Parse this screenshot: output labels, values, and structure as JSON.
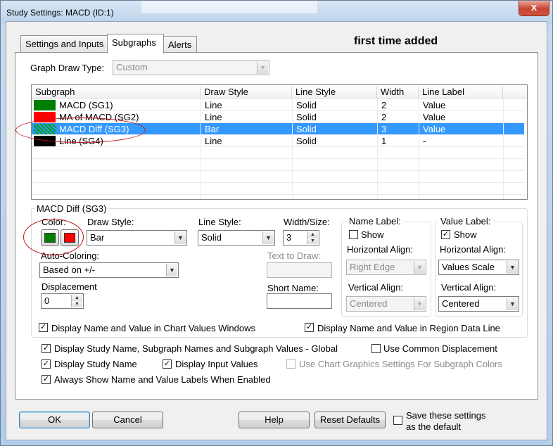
{
  "window": {
    "title": "Study Settings: MACD (ID:1)",
    "close_glyph": "x"
  },
  "tabs": [
    {
      "label": "Settings and Inputs",
      "active": false
    },
    {
      "label": "Subgraphs",
      "active": true
    },
    {
      "label": "Alerts",
      "active": false
    }
  ],
  "annotation_note": "first time added",
  "graph_draw_type": {
    "label": "Graph Draw Type:",
    "value": "Custom"
  },
  "subgraph_list": {
    "columns": [
      "Subgraph",
      "Draw Style",
      "Line Style",
      "Width",
      "Line Label"
    ],
    "rows": [
      {
        "color": "#008000",
        "name": "MACD (SG1)",
        "draw_style": "Line",
        "line_style": "Solid",
        "width": "2",
        "line_label": "Value",
        "selected": false
      },
      {
        "color": "#ff0000",
        "name": "MA of MACD (SG2)",
        "draw_style": "Line",
        "line_style": "Solid",
        "width": "2",
        "line_label": "Value",
        "selected": false
      },
      {
        "color": "#00a000",
        "name": "MACD Diff (SG3)",
        "draw_style": "Bar",
        "line_style": "Solid",
        "width": "3",
        "line_label": "Value",
        "selected": true
      },
      {
        "color": "#000000",
        "name": "Line (SG4)",
        "draw_style": "Line",
        "line_style": "Solid",
        "width": "1",
        "line_label": "-",
        "selected": false
      }
    ]
  },
  "selected_group": {
    "title": "MACD Diff (SG3)",
    "color_label": "Color:",
    "primary_color": "#008000",
    "secondary_color": "#ff0000",
    "draw_style_label": "Draw Style:",
    "draw_style_value": "Bar",
    "line_style_label": "Line Style:",
    "line_style_value": "Solid",
    "width_label": "Width/Size:",
    "width_value": "3",
    "auto_coloring_label": "Auto-Coloring:",
    "auto_coloring_value": "Based on +/-",
    "text_to_draw_label": "Text to Draw:",
    "text_to_draw_value": "",
    "displacement_label": "Displacement",
    "displacement_value": "0",
    "short_name_label": "Short Name:",
    "short_name_value": "",
    "name_label": {
      "title": "Name Label:",
      "show_label": "Show",
      "show_checked": false,
      "h_align_label": "Horizontal Align:",
      "h_align_value": "Right Edge",
      "v_align_label": "Vertical Align:",
      "v_align_value": "Centered"
    },
    "value_label": {
      "title": "Value Label:",
      "show_label": "Show",
      "show_checked": true,
      "h_align_label": "Horizontal Align:",
      "h_align_value": "Values Scale",
      "v_align_label": "Vertical Align:",
      "v_align_value": "Centered"
    },
    "display_chart_values_label": "Display Name and Value in Chart Values Windows",
    "display_chart_values_checked": true,
    "display_region_label": "Display Name and Value in Region Data Line",
    "display_region_checked": true
  },
  "global_options": {
    "display_study_global_label": "Display Study Name, Subgraph Names and Subgraph Values - Global",
    "display_study_global_checked": true,
    "use_common_displacement_label": "Use Common Displacement",
    "use_common_displacement_checked": false,
    "display_study_name_label": "Display Study Name",
    "display_study_name_checked": true,
    "display_input_values_label": "Display Input Values",
    "display_input_values_checked": true,
    "use_chart_graphics_label": "Use Chart Graphics Settings For Subgraph Colors",
    "use_chart_graphics_checked": false,
    "always_show_label": "Always Show Name and Value Labels When Enabled",
    "always_show_checked": true
  },
  "buttons": {
    "ok": "OK",
    "cancel": "Cancel",
    "help": "Help",
    "reset": "Reset Defaults",
    "save_settings_label_line1": "Save these settings",
    "save_settings_label_line2": "as the default",
    "save_settings_checked": false
  },
  "glyphs": {
    "check": "✓",
    "combo_arrow": "▼",
    "spin_up": "▲",
    "spin_down": "▼"
  }
}
